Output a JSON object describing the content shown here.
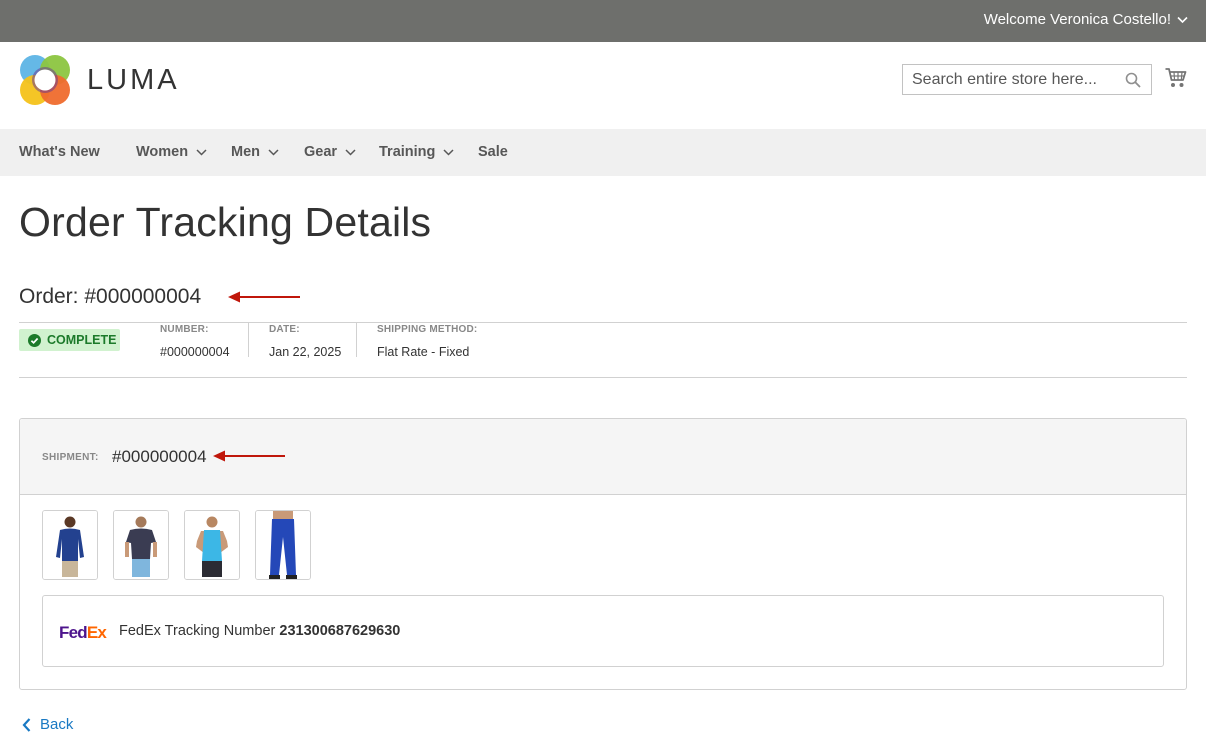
{
  "topbar": {
    "welcome": "Welcome Veronica Costello!"
  },
  "header": {
    "logo_text": "LUMA",
    "search_placeholder": "Search entire store here...",
    "icons": {
      "search": "search-icon",
      "cart": "cart-icon"
    }
  },
  "nav": {
    "items": [
      {
        "label": "What's New",
        "has_dropdown": false
      },
      {
        "label": "Women",
        "has_dropdown": true
      },
      {
        "label": "Men",
        "has_dropdown": true
      },
      {
        "label": "Gear",
        "has_dropdown": true
      },
      {
        "label": "Training",
        "has_dropdown": true
      },
      {
        "label": "Sale",
        "has_dropdown": false
      }
    ]
  },
  "page": {
    "title": "Order Tracking Details",
    "order_title": "Order: #000000004",
    "status": "COMPLETE",
    "meta": [
      {
        "label": "NUMBER:",
        "value": "#000000004"
      },
      {
        "label": "DATE:",
        "value": "Jan 22, 2025"
      },
      {
        "label": "SHIPPING METHOD:",
        "value": "Flat Rate - Fixed"
      }
    ]
  },
  "shipment": {
    "label": "SHIPMENT:",
    "number": "#000000004",
    "carrier_logo": {
      "fed": "Fed",
      "ex": "Ex"
    },
    "tracking_label": "FedEx Tracking Number",
    "tracking_number": "231300687629630"
  },
  "back_label": "Back",
  "colors": {
    "topbar": "#6e6f6c",
    "nav_bg": "#f0f0f0",
    "status_bg": "#d1f2cf",
    "status_text": "#1c7a2a",
    "link": "#1979c3",
    "annotation_arrow": "#c0170b",
    "fedex_purple": "#4d148c",
    "fedex_orange": "#ff6600"
  }
}
